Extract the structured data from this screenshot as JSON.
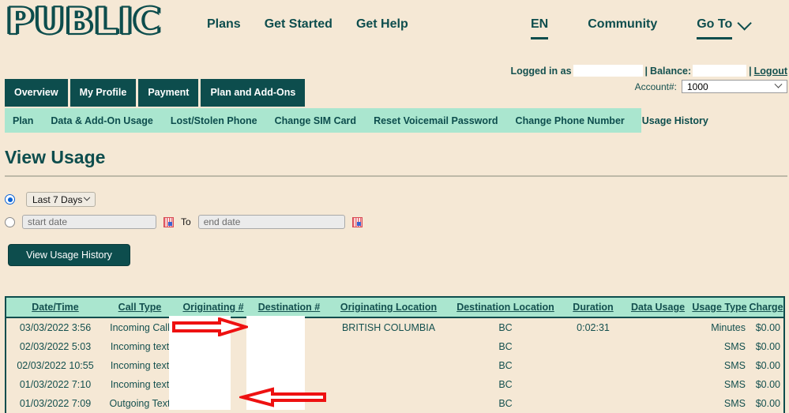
{
  "brand": {
    "logo_text": "PUBLIC"
  },
  "header": {
    "nav_main": [
      {
        "label": "Plans"
      },
      {
        "label": "Get Started"
      },
      {
        "label": "Get Help"
      }
    ],
    "nav_right": [
      {
        "label": "EN",
        "underlined": true
      },
      {
        "label": "Community",
        "underlined": false
      },
      {
        "label": "Go To",
        "underlined": true,
        "has_chevron": true
      }
    ]
  },
  "account_bar": {
    "logged_in_label": "Logged in as",
    "logged_in_value": "",
    "separator1": "|",
    "balance_label": "Balance:",
    "balance_value": "",
    "separator2": "|",
    "logout_label": "Logout",
    "account_label": "Account#:",
    "account_value": "1000",
    "account_options": [
      "1000"
    ]
  },
  "tabs": [
    {
      "label": "Overview",
      "active": true
    },
    {
      "label": "My Profile",
      "active": false
    },
    {
      "label": "Payment",
      "active": false
    },
    {
      "label": "Plan and Add-Ons",
      "active": false
    }
  ],
  "subnav": [
    {
      "label": "Plan"
    },
    {
      "label": "Data & Add-On Usage"
    },
    {
      "label": "Lost/Stolen Phone"
    },
    {
      "label": "Change SIM Card"
    },
    {
      "label": "Reset Voicemail Password"
    },
    {
      "label": "Change Phone Number"
    },
    {
      "label": "Usage History"
    }
  ],
  "page": {
    "title": "View Usage"
  },
  "filters": {
    "preset_radio_checked": true,
    "preset_value": "Last 7 Days",
    "preset_options": [
      "Last 7 Days"
    ],
    "custom_radio_checked": false,
    "start_placeholder": "start date",
    "start_value": "",
    "to_label": "To",
    "end_placeholder": "end date",
    "end_value": "",
    "submit_label": "View Usage History"
  },
  "table": {
    "columns": [
      "Date/Time",
      "Call Type",
      "Originating #",
      "Destination #",
      "Originating Location",
      "Destination Location",
      "Duration",
      "Data Usage",
      "Usage Type",
      "Charge"
    ],
    "rows": [
      {
        "datetime": "03/03/2022 3:56",
        "call_type": "Incoming Call",
        "originating": "",
        "destination": "",
        "originating_location": "BRITISH COLUMBIA",
        "destination_location": "BC",
        "duration": "0:02:31",
        "data_usage": "",
        "usage_type": "Minutes",
        "charge": "$0.00"
      },
      {
        "datetime": "02/03/2022 5:03",
        "call_type": "Incoming text",
        "originating": "",
        "destination": "",
        "originating_location": "",
        "destination_location": "BC",
        "duration": "",
        "data_usage": "",
        "usage_type": "SMS",
        "charge": "$0.00"
      },
      {
        "datetime": "02/03/2022 10:55",
        "call_type": "Incoming text",
        "originating": "",
        "destination": "",
        "originating_location": "",
        "destination_location": "BC",
        "duration": "",
        "data_usage": "",
        "usage_type": "SMS",
        "charge": "$0.00"
      },
      {
        "datetime": "01/03/2022 7:10",
        "call_type": "Incoming text",
        "originating": "",
        "destination": "",
        "originating_location": "",
        "destination_location": "BC",
        "duration": "",
        "data_usage": "",
        "usage_type": "SMS",
        "charge": "$0.00"
      },
      {
        "datetime": "01/03/2022 7:09",
        "call_type": "Outgoing Text",
        "originating": "",
        "destination": "",
        "originating_location": "",
        "destination_location": "BC",
        "duration": "",
        "data_usage": "",
        "usage_type": "SMS",
        "charge": "$0.00"
      }
    ]
  },
  "annotations": [
    {
      "name": "arrow-pointing-right",
      "direction": "right",
      "color": "#ee1111"
    },
    {
      "name": "arrow-pointing-left",
      "direction": "left",
      "color": "#ee1111"
    }
  ],
  "colors": {
    "page_background": "#f5e8d5",
    "brand_dark_teal": "#0d4d4d",
    "mint": "#aae6cf",
    "text_teal": "#14504f",
    "annotation_red": "#ee1111"
  }
}
